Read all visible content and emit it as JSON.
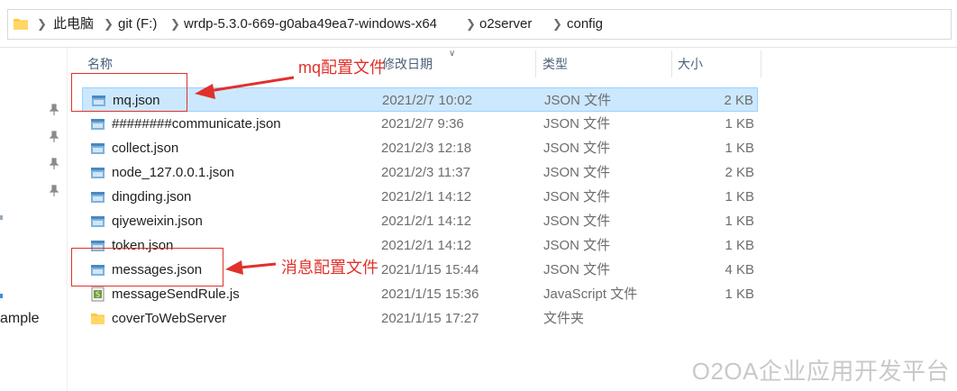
{
  "breadcrumb": {
    "items": [
      "此电脑",
      "git (F:)",
      "wrdp-5.3.0-669-g0aba49ea7-windows-x64",
      "o2server",
      "config"
    ]
  },
  "nav": {
    "partial_label": "ample"
  },
  "columns": {
    "name": "名称",
    "date": "修改日期",
    "type": "类型",
    "size": "大小"
  },
  "files": [
    {
      "name": "mq.json",
      "date": "2021/2/7 10:02",
      "type": "JSON 文件",
      "size": "2 KB",
      "icon": "json-file-icon",
      "selected": true
    },
    {
      "name": "########communicate.json",
      "date": "2021/2/7 9:36",
      "type": "JSON 文件",
      "size": "1 KB",
      "icon": "json-file-icon"
    },
    {
      "name": "collect.json",
      "date": "2021/2/3 12:18",
      "type": "JSON 文件",
      "size": "1 KB",
      "icon": "json-file-icon"
    },
    {
      "name": "node_127.0.0.1.json",
      "date": "2021/2/3 11:37",
      "type": "JSON 文件",
      "size": "2 KB",
      "icon": "json-file-icon"
    },
    {
      "name": "dingding.json",
      "date": "2021/2/1 14:12",
      "type": "JSON 文件",
      "size": "1 KB",
      "icon": "json-file-icon"
    },
    {
      "name": "qiyeweixin.json",
      "date": "2021/2/1 14:12",
      "type": "JSON 文件",
      "size": "1 KB",
      "icon": "json-file-icon"
    },
    {
      "name": "token.json",
      "date": "2021/2/1 14:12",
      "type": "JSON 文件",
      "size": "1 KB",
      "icon": "json-file-icon"
    },
    {
      "name": "messages.json",
      "date": "2021/1/15 15:44",
      "type": "JSON 文件",
      "size": "4 KB",
      "icon": "json-file-icon"
    },
    {
      "name": "messageSendRule.js",
      "date": "2021/1/15 15:36",
      "type": "JavaScript 文件",
      "size": "1 KB",
      "icon": "js-file-icon"
    },
    {
      "name": "coverToWebServer",
      "date": "2021/1/15 17:27",
      "type": "文件夹",
      "size": "",
      "icon": "folder-icon"
    }
  ],
  "annotations": {
    "mq": "mq配置文件",
    "messages": "消息配置文件"
  },
  "watermark": "O2OA企业应用开发平台",
  "colors": {
    "selection": "#cce8ff",
    "annotation": "#e0312b",
    "folder": "#ffc93c"
  }
}
